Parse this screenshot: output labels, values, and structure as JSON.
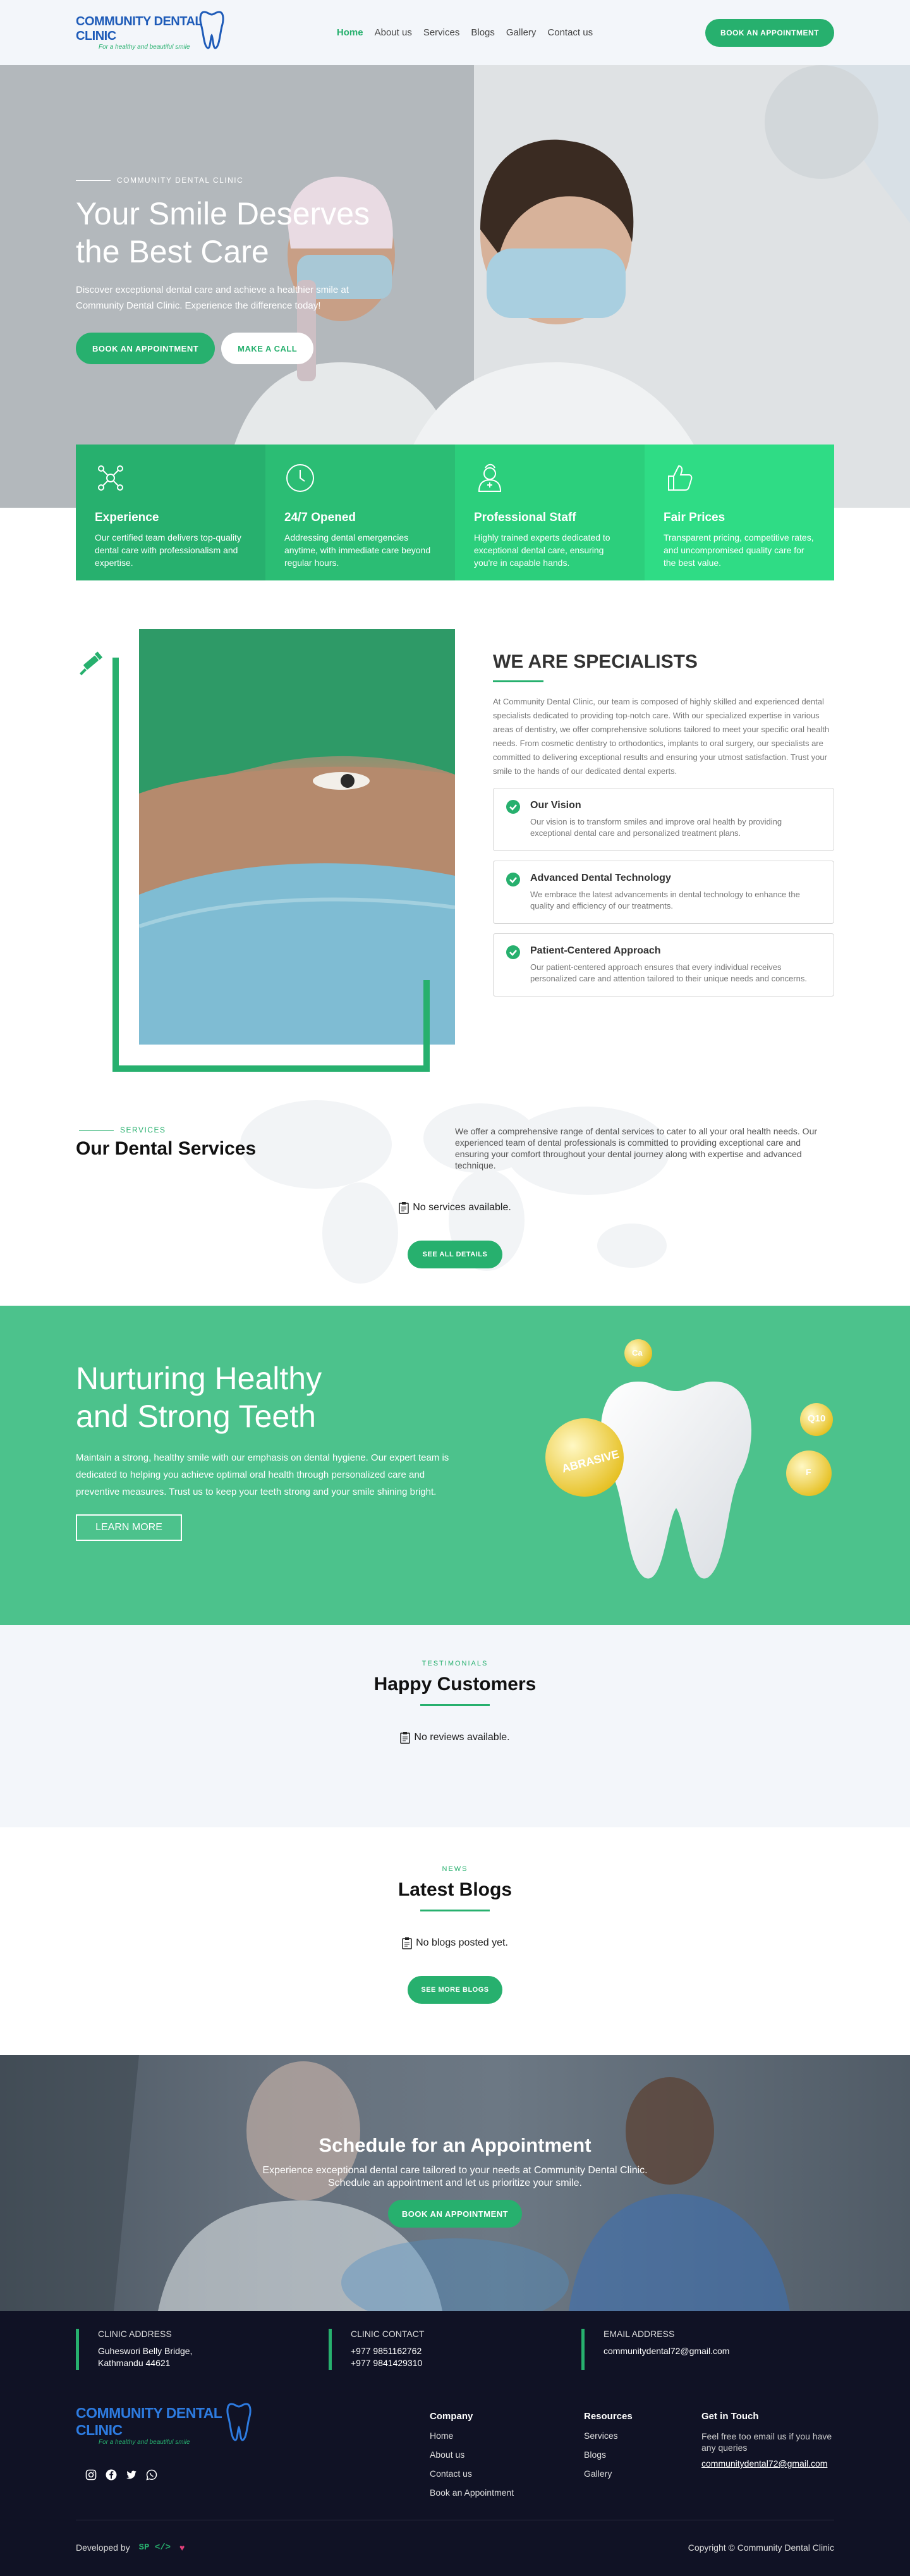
{
  "header": {
    "logo_title": "COMMUNITY DENTAL CLINIC",
    "logo_tagline": "For a healthy and beautiful smile",
    "nav": [
      {
        "label": "Home",
        "active": true
      },
      {
        "label": "About us",
        "active": false
      },
      {
        "label": "Services",
        "active": false
      },
      {
        "label": "Blogs",
        "active": false
      },
      {
        "label": "Gallery",
        "active": false
      },
      {
        "label": "Contact us",
        "active": false
      }
    ],
    "cta": "BOOK AN APPOINTMENT"
  },
  "hero": {
    "eyebrow": "COMMUNITY DENTAL CLINIC",
    "title_line1": "Your Smile Deserves",
    "title_line2": "the Best Care",
    "description": "Discover exceptional dental care and achieve a healthier smile at Community Dental Clinic. Experience the difference today!",
    "primary_button": "BOOK AN APPOINTMENT",
    "secondary_button": "MAKE A CALL"
  },
  "features": [
    {
      "icon": "network-icon",
      "title": "Experience",
      "text": "Our certified team delivers top-quality dental care with professionalism and expertise.",
      "color": "#27b06e"
    },
    {
      "icon": "clock-icon",
      "title": "24/7 Opened",
      "text": "Addressing dental emergencies anytime, with immediate care beyond regular hours.",
      "color": "#2bbd74"
    },
    {
      "icon": "doctor-icon",
      "title": "Professional Staff",
      "text": "Highly trained experts dedicated to exceptional dental care, ensuring you're in capable hands.",
      "color": "#2ccf7c"
    },
    {
      "icon": "thumbs-up-icon",
      "title": "Fair Prices",
      "text": "Transparent pricing, competitive rates, and uncompromised quality care for the best value.",
      "color": "#2fdc85"
    }
  ],
  "specialists": {
    "title": "WE ARE SPECIALISTS",
    "description": "At Community Dental Clinic, our team is composed of highly skilled and experienced dental specialists dedicated to providing top-notch care. With our specialized expertise in various areas of dentistry, we offer comprehensive solutions tailored to meet your specific oral health needs. From cosmetic dentistry to orthodontics, implants to oral surgery, our specialists are committed to delivering exceptional results and ensuring your utmost satisfaction. Trust your smile to the hands of our dedicated dental experts.",
    "cards": [
      {
        "title": "Our Vision",
        "text": "Our vision is to transform smiles and improve oral health by providing exceptional dental care and personalized treatment plans."
      },
      {
        "title": "Advanced Dental Technology",
        "text": "We embrace the latest advancements in dental technology to enhance the quality and efficiency of our treatments."
      },
      {
        "title": "Patient-Centered Approach",
        "text": "Our patient-centered approach ensures that every individual receives personalized care and attention tailored to their unique needs and concerns."
      }
    ]
  },
  "services": {
    "eyebrow": "SERVICES",
    "title": "Our Dental Services",
    "description": "We offer a comprehensive range of dental services to cater to all your oral health needs. Our experienced team of dental professionals is committed to providing exceptional care and ensuring your comfort throughout your dental journey along with expertise and advanced technique.",
    "empty": "No services available.",
    "button": "SEE ALL DETAILS"
  },
  "nurture": {
    "title_line1": "Nurturing Healthy",
    "title_line2": "and Strong Teeth",
    "description": "Maintain a strong, healthy smile with our emphasis on dental hygiene. Our expert team is dedicated to helping you achieve optimal oral health through personalized care and preventive measures. Trust us to keep your teeth strong and your smile shining bright.",
    "button": "LEARN MORE",
    "bubble_labels": [
      "ABRASIVE",
      "Ca",
      "F",
      "Q10"
    ]
  },
  "testimonials": {
    "eyebrow": "TESTIMONIALS",
    "title": "Happy Customers",
    "empty": "No reviews available."
  },
  "blogs": {
    "eyebrow": "NEWS",
    "title": "Latest Blogs",
    "empty": "No blogs posted yet.",
    "button": "SEE MORE BLOGS"
  },
  "appointment": {
    "title": "Schedule for an Appointment",
    "line1": "Experience exceptional dental care tailored to your needs at Community Dental Clinic.",
    "line2": "Schedule an appointment and let us prioritize your smile.",
    "button": "BOOK AN APPOINTMENT"
  },
  "footer": {
    "address_label": "CLINIC ADDRESS",
    "address_line1": "Guheswori Belly Bridge,",
    "address_line2": "Kathmandu 44621",
    "contact_label": "CLINIC CONTACT",
    "phone1": "+977 9851162762",
    "phone2": "+977 9841429310",
    "email_label": "EMAIL ADDRESS",
    "email": "communitydental72@gmail.com",
    "company_title": "Company",
    "company_links": [
      "Home",
      "About us",
      "Contact us",
      "Book an Appointment"
    ],
    "resources_title": "Resources",
    "resources_links": [
      "Services",
      "Blogs",
      "Gallery"
    ],
    "touch_title": "Get in Touch",
    "touch_text": "Feel free too email us if you have any queries",
    "touch_email": "communitydental72@gmail.com",
    "developed_by": "Developed by",
    "dev_brand": "SP",
    "copyright": "Copyright © Community Dental Clinic",
    "socials": [
      "instagram-icon",
      "facebook-icon",
      "twitter-icon",
      "whatsapp-icon"
    ]
  },
  "colors": {
    "accent": "#27b06e",
    "brand_blue": "#1e5bb8",
    "footer_bg": "#101225",
    "band_green": "#4cc28c"
  }
}
